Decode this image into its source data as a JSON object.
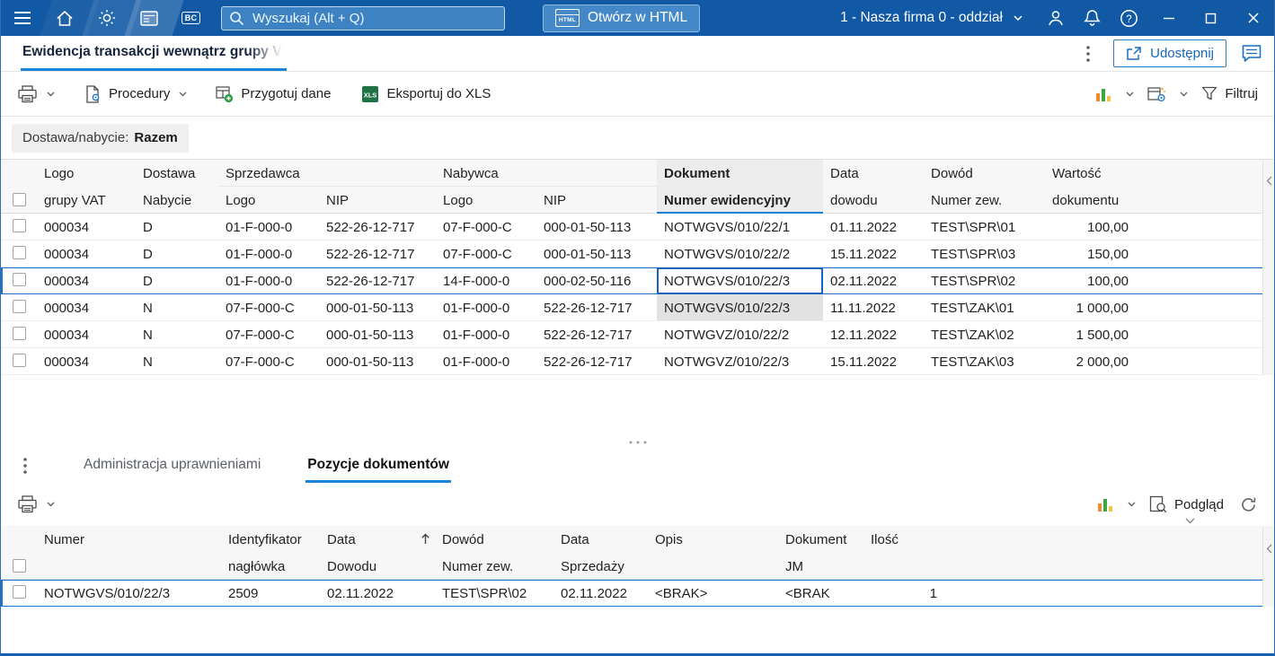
{
  "colors": {
    "topbar": "#1159A5",
    "accent": "#1B84D8",
    "selection": "#1C73C8",
    "link": "#1A66B3",
    "header-bg": "#F7F7F8",
    "grid-line": "#EDEDED"
  },
  "titlebar": {
    "search_placeholder": "Wyszukaj (Alt + Q)",
    "open_html_label": "Otwórz w HTML",
    "html_badge": "HTML",
    "bc_badge": "BC",
    "company": "1 - Nasza firma 0 - oddział"
  },
  "tabbar": {
    "active_tab": "Ewidencja transakcji wewnątrz grupy VAT",
    "share_label": "Udostępnij"
  },
  "toolbar": {
    "procedury_label": "Procedury",
    "przygotuj_label": "Przygotuj dane",
    "eksport_label": "Eksportuj do XLS",
    "xls_badge": "XLS",
    "filtruj_label": "Filtruj"
  },
  "group_band": {
    "label": "Dostawa/nabycie:",
    "value": "Razem"
  },
  "main_grid": {
    "headers": {
      "logo_l1": "Logo",
      "logo_l2": "grupy VAT",
      "dn_l1": "Dostawa",
      "dn_l2": "Nabycie",
      "sprzedawca": "Sprzedawca",
      "nabywca": "Nabywca",
      "s_logo": "Logo",
      "s_nip": "NIP",
      "n_logo": "Logo",
      "n_nip": "NIP",
      "dok_l1": "Dokument",
      "dok_l2": "Numer ewidencyjny",
      "data_l1": "Data",
      "data_l2": "dowodu",
      "dowod_l1": "Dowód",
      "dowod_l2": "Numer zew.",
      "wart_l1": "Wartość",
      "wart_l2": "dokumentu"
    },
    "rows": [
      {
        "logo": "000034",
        "dn": "D",
        "slogo": "01-F-000-0",
        "snip": "522-26-12-717",
        "nlogo": "07-F-000-C",
        "nnip": "000-01-50-113",
        "dok": "NOTWGVS/010/22/1",
        "data": "01.11.2022",
        "dowod": "TEST\\SPR\\01",
        "wart": "100,00"
      },
      {
        "logo": "000034",
        "dn": "D",
        "slogo": "01-F-000-0",
        "snip": "522-26-12-717",
        "nlogo": "07-F-000-C",
        "nnip": "000-01-50-113",
        "dok": "NOTWGVS/010/22/2",
        "data": "15.11.2022",
        "dowod": "TEST\\SPR\\03",
        "wart": "150,00"
      },
      {
        "logo": "000034",
        "dn": "D",
        "slogo": "01-F-000-0",
        "snip": "522-26-12-717",
        "nlogo": "14-F-000-0",
        "nnip": "000-02-50-116",
        "dok": "NOTWGVS/010/22/3",
        "data": "02.11.2022",
        "dowod": "TEST\\SPR\\02",
        "wart": "100,00"
      },
      {
        "logo": "000034",
        "dn": "N",
        "slogo": "07-F-000-C",
        "snip": "000-01-50-113",
        "nlogo": "01-F-000-0",
        "nnip": "522-26-12-717",
        "dok": "NOTWGVS/010/22/3",
        "data": "11.11.2022",
        "dowod": "TEST\\ZAK\\01",
        "wart": "1 000,00"
      },
      {
        "logo": "000034",
        "dn": "N",
        "slogo": "07-F-000-C",
        "snip": "000-01-50-113",
        "nlogo": "01-F-000-0",
        "nnip": "522-26-12-717",
        "dok": "NOTWGVZ/010/22/2",
        "data": "12.11.2022",
        "dowod": "TEST\\ZAK\\02",
        "wart": "1 500,00"
      },
      {
        "logo": "000034",
        "dn": "N",
        "slogo": "07-F-000-C",
        "snip": "000-01-50-113",
        "nlogo": "01-F-000-0",
        "nnip": "522-26-12-717",
        "dok": "NOTWGVZ/010/22/3",
        "data": "15.11.2022",
        "dowod": "TEST\\ZAK\\03",
        "wart": "2 000,00"
      }
    ]
  },
  "bottom_panel": {
    "tab_admin": "Administracja uprawnieniami",
    "tab_pozycje": "Pozycje dokumentów",
    "podglad_label": "Podgląd",
    "grid": {
      "headers": {
        "numer": "Numer",
        "ident_l1": "Identyfikator",
        "ident_l2": "nagłówka",
        "dd_l1": "Data",
        "dd_l2": "Dowodu",
        "dowod_l1": "Dowód",
        "dowod_l2": "Numer zew.",
        "ds_l1": "Data",
        "ds_l2": "Sprzedaży",
        "opis": "Opis",
        "dok_l1": "Dokument",
        "dok_l2": "JM",
        "ilosc": "Ilość"
      },
      "rows": [
        {
          "numer": "NOTWGVS/010/22/3",
          "ident": "2509",
          "data_dowodu": "02.11.2022",
          "dowod": "TEST\\SPR\\02",
          "data_sprzedazy": "02.11.2022",
          "opis": "<BRAK>",
          "dokument_jm": "<BRAK",
          "ilosc": "1"
        }
      ]
    }
  }
}
